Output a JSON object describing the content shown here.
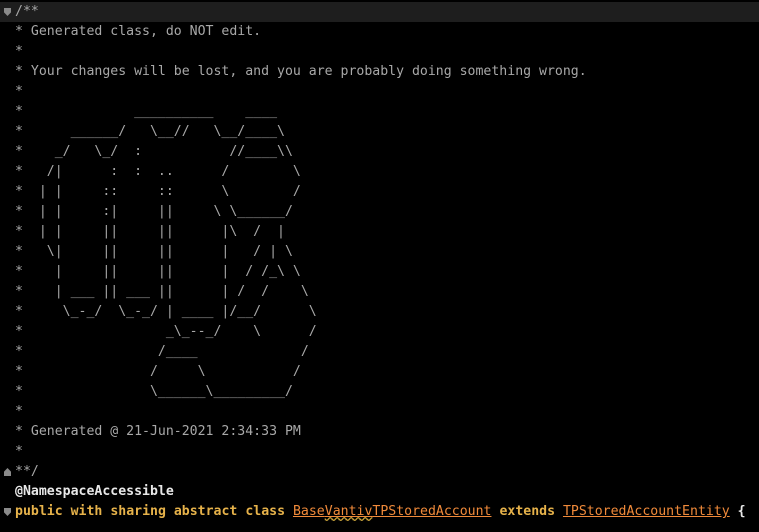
{
  "editor": {
    "lines": [
      "/**",
      " * Generated class, do NOT edit.",
      " *",
      " * Your changes will be lost, and you are probably doing something wrong.",
      " *",
      " *              __________    ____",
      " *      ______/   \\__//   \\__/____\\",
      " *    _/   \\_/  :           //____\\\\",
      " *   /|      :  :  ..      /        \\",
      " *  | |     ::     ::      \\        /",
      " *  | |     :|     ||     \\ \\______/",
      " *  | |     ||     ||      |\\  /  |",
      " *   \\|     ||     ||      |   / | \\",
      " *    |     ||     ||      |  / /_\\ \\",
      " *    | ___ || ___ ||      | /  /    \\",
      " *     \\_-_/  \\_-_/ | ____ |/__/      \\",
      " *                  _\\_--_/    \\      /",
      " *                 /____             /",
      " *                /     \\           /",
      " *                \\______\\_________/",
      " *",
      " * Generated @ 21-Jun-2021 2:34:33 PM",
      " *",
      " **/"
    ],
    "annotation": "@NamespaceAccessible",
    "declaration": {
      "public": "public",
      "with": "with",
      "sharing": "sharing",
      "abstract": "abstract",
      "class": "class",
      "class_name": "BaseVantivTPStoredAccount",
      "extends": "extends",
      "parent_name": "TPStoredAccountEntity",
      "brace": "{"
    }
  }
}
